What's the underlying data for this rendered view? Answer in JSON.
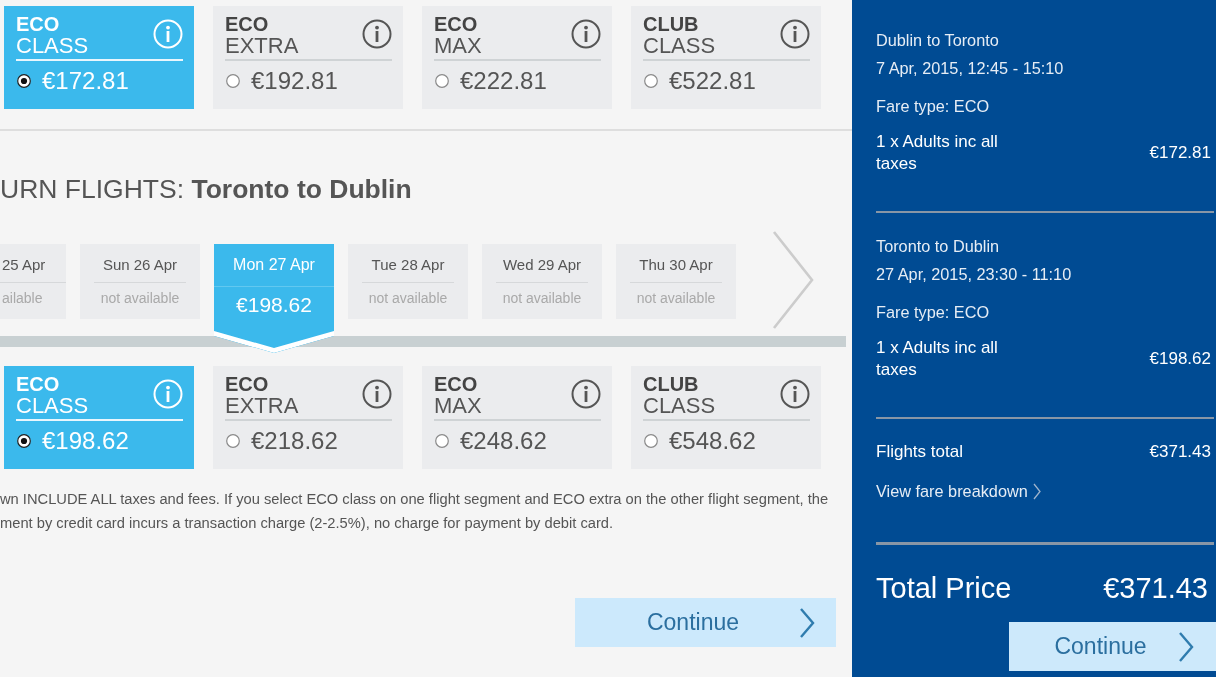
{
  "outbound_fares": [
    {
      "name": "ECO",
      "subname": "CLASS",
      "price": "€172.81",
      "selected": true
    },
    {
      "name": "ECO",
      "subname": "EXTRA",
      "price": "€192.81",
      "selected": false
    },
    {
      "name": "ECO",
      "subname": "MAX",
      "price": "€222.81",
      "selected": false
    },
    {
      "name": "CLUB",
      "subname": "CLASS",
      "price": "€522.81",
      "selected": false
    }
  ],
  "return_flights": {
    "title": "URN FLIGHTS: **Toronto to Dublin**",
    "dates": [
      {
        "day": "25 Apr",
        "info": "ailable",
        "selected": false
      },
      {
        "day": "Sun 26 Apr",
        "info": "not available",
        "selected": false
      },
      {
        "day": "Mon 27 Apr",
        "info": "€198.62",
        "selected": true
      },
      {
        "day": "Tue 28 Apr",
        "info": "not available",
        "selected": false
      },
      {
        "day": "Wed 29 Apr",
        "info": "not available",
        "selected": false
      },
      {
        "day": "Thu 30 Apr",
        "info": "not available",
        "selected": false
      }
    ],
    "fares": [
      {
        "name": "ECO",
        "subname": "CLASS",
        "price": "€198.62",
        "selected": true
      },
      {
        "name": "ECO",
        "subname": "EXTRA",
        "price": "€218.62",
        "selected": false
      },
      {
        "name": "ECO",
        "subname": "MAX",
        "price": "€248.62",
        "selected": false
      },
      {
        "name": "CLUB",
        "subname": "CLASS",
        "price": "€548.62",
        "selected": false
      }
    ]
  },
  "note_lines": [
    "wn INCLUDE ALL taxes and fees. If you select ECO class on one flight segment and ECO extra on the other flight segment, the",
    "ment by credit card incurs a transaction charge (2-2.5%), no charge for payment by debit card."
  ],
  "continue_button": "Continue",
  "summary": {
    "flights": [
      {
        "route": "Dublin to Toronto",
        "time": "7 Apr, 2015, 12:45 - 15:10",
        "fare_type": "Fare type: ECO",
        "passengers": "1 x Adults inc all taxes",
        "price": "€172.81"
      },
      {
        "route": "Toronto to Dublin",
        "time": "27 Apr, 2015, 23:30 - 11:10",
        "fare_type": "Fare type: ECO",
        "passengers": "1 x Adults inc all taxes",
        "price": "€198.62"
      }
    ],
    "flights_total_label": "Flights total",
    "flights_total": "€371.43",
    "breakdown_link": "View fare breakdown",
    "total_label": "Total Price",
    "total": "€371.43",
    "continue_button": "Continue"
  }
}
